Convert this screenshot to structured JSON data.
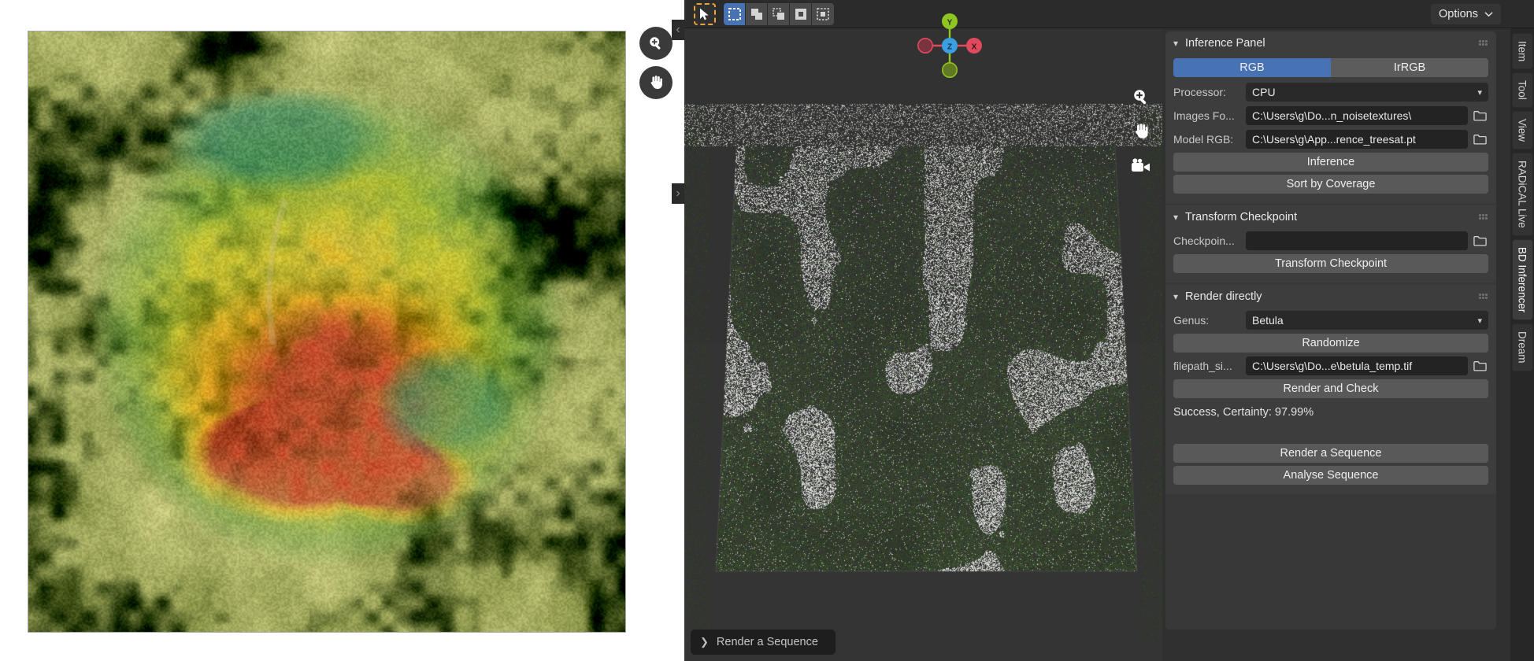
{
  "toolbar": {
    "select_tool_icon": "cursor-arrow-icon",
    "mode_buttons": [
      {
        "name": "set-new-selection",
        "icon": "select-new-icon",
        "active": true
      },
      {
        "name": "extend-selection",
        "icon": "select-extend-icon",
        "active": false
      },
      {
        "name": "subtract-selection",
        "icon": "select-subtract-icon",
        "active": false
      },
      {
        "name": "intersect-selection",
        "icon": "select-intersect-icon",
        "active": false
      },
      {
        "name": "invert-selection",
        "icon": "select-invert-icon",
        "active": false
      }
    ],
    "options_label": "Options",
    "options_chevron": "chevron-down-icon"
  },
  "left_pane": {
    "zoom_tool_icon": "magnifier-plus-icon",
    "pan_tool_icon": "hand-icon",
    "collapse_left_icon": "chevron-left-icon",
    "collapse_right_icon": "chevron-right-icon"
  },
  "viewport": {
    "gizmo": {
      "axes": [
        {
          "label": "Y",
          "color": "#8ec520",
          "filled": true
        },
        {
          "label": "X",
          "color": "#e04a5e",
          "filled": true
        },
        {
          "label": "Z",
          "color": "#3b9ee0",
          "filled": true
        },
        {
          "label": "",
          "color": "#7a3340",
          "filled": false
        },
        {
          "label": "",
          "color": "#5f7a22",
          "filled": false
        }
      ]
    },
    "tools": [
      {
        "name": "zoom-tool",
        "icon": "magnifier-plus-icon"
      },
      {
        "name": "pan-tool",
        "icon": "hand-icon"
      },
      {
        "name": "camera-tool",
        "icon": "camera-icon"
      }
    ],
    "status_pill": {
      "chevron": "chevron-right-icon",
      "label": "Render a Sequence"
    }
  },
  "panels": [
    {
      "id": "inference-panel",
      "title": "Inference Panel",
      "collapsed": false,
      "toggles": [
        {
          "label": "RGB",
          "active": true
        },
        {
          "label": "IrRGB",
          "active": false
        }
      ],
      "rows": [
        {
          "label": "Processor:",
          "value": "CPU",
          "type": "select",
          "folder": false
        },
        {
          "label": "Images Fo...",
          "value": "C:\\Users\\g\\Do...n_noisetextures\\",
          "type": "path",
          "folder": true
        },
        {
          "label": "Model RGB:",
          "value": "C:\\Users\\g\\App...rence_treesat.pt",
          "type": "path",
          "folder": true
        }
      ],
      "buttons": [
        "Inference",
        "Sort by Coverage"
      ]
    },
    {
      "id": "transform-checkpoint-panel",
      "title": "Transform Checkpoint",
      "collapsed": false,
      "rows": [
        {
          "label": "Checkpoin...",
          "value": "",
          "type": "path",
          "folder": true
        }
      ],
      "buttons": [
        "Transform Checkpoint"
      ]
    },
    {
      "id": "render-directly-panel",
      "title": "Render directly",
      "collapsed": false,
      "rows": [
        {
          "label": "Genus:",
          "value": "Betula",
          "type": "select",
          "folder": false
        }
      ],
      "buttons_before": [
        "Randomize"
      ],
      "rows2": [
        {
          "label": "filepath_si...",
          "value": "C:\\Users\\g\\Do...e\\betula_temp.tif",
          "type": "path",
          "folder": true
        }
      ],
      "buttons": [
        "Render and Check"
      ],
      "status": "Success, Certainty: 97.99%",
      "buttons_footer": [
        "Render a Sequence",
        "Analyse Sequence"
      ]
    }
  ],
  "tabs": [
    {
      "label": "Item",
      "active": false
    },
    {
      "label": "Tool",
      "active": false
    },
    {
      "label": "View",
      "active": false
    },
    {
      "label": "RADiCAL Live",
      "active": false
    },
    {
      "label": "BD Inferencer",
      "active": true
    },
    {
      "label": "Dream",
      "active": false
    }
  ],
  "colors": {
    "accent_blue": "#4772b3",
    "panel_bg": "#3d3d3d",
    "app_bg": "#303030",
    "field_bg": "#232323",
    "button_bg": "#595959",
    "axis_x": "#e04a5e",
    "axis_y": "#8ec520",
    "axis_z": "#3b9ee0"
  }
}
